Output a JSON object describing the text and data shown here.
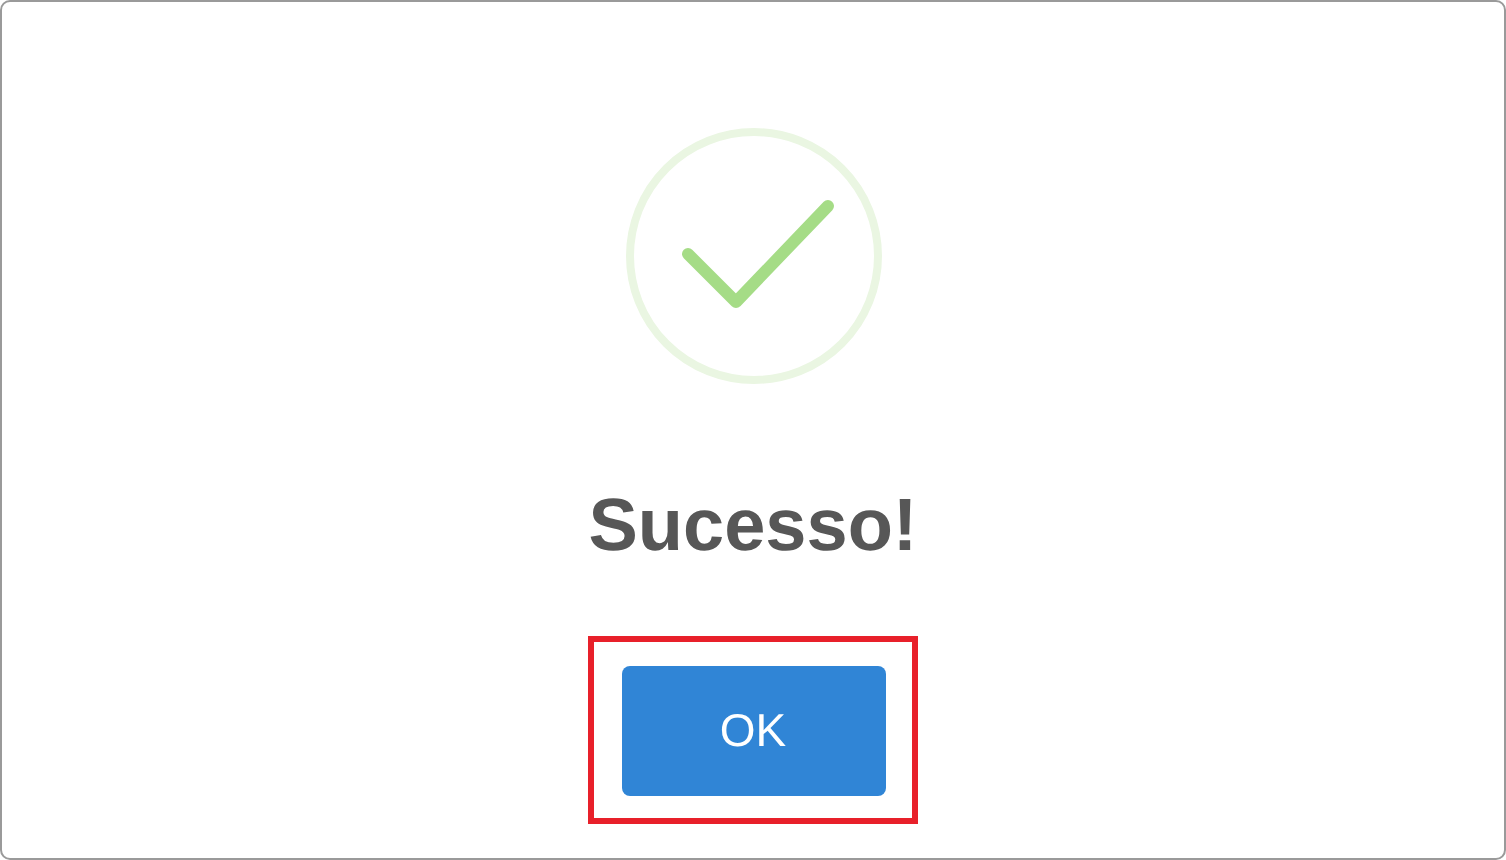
{
  "dialog": {
    "icon": {
      "kind": "success"
    },
    "title": "Sucesso!",
    "button": {
      "label": "OK",
      "highlighted": true
    }
  }
}
